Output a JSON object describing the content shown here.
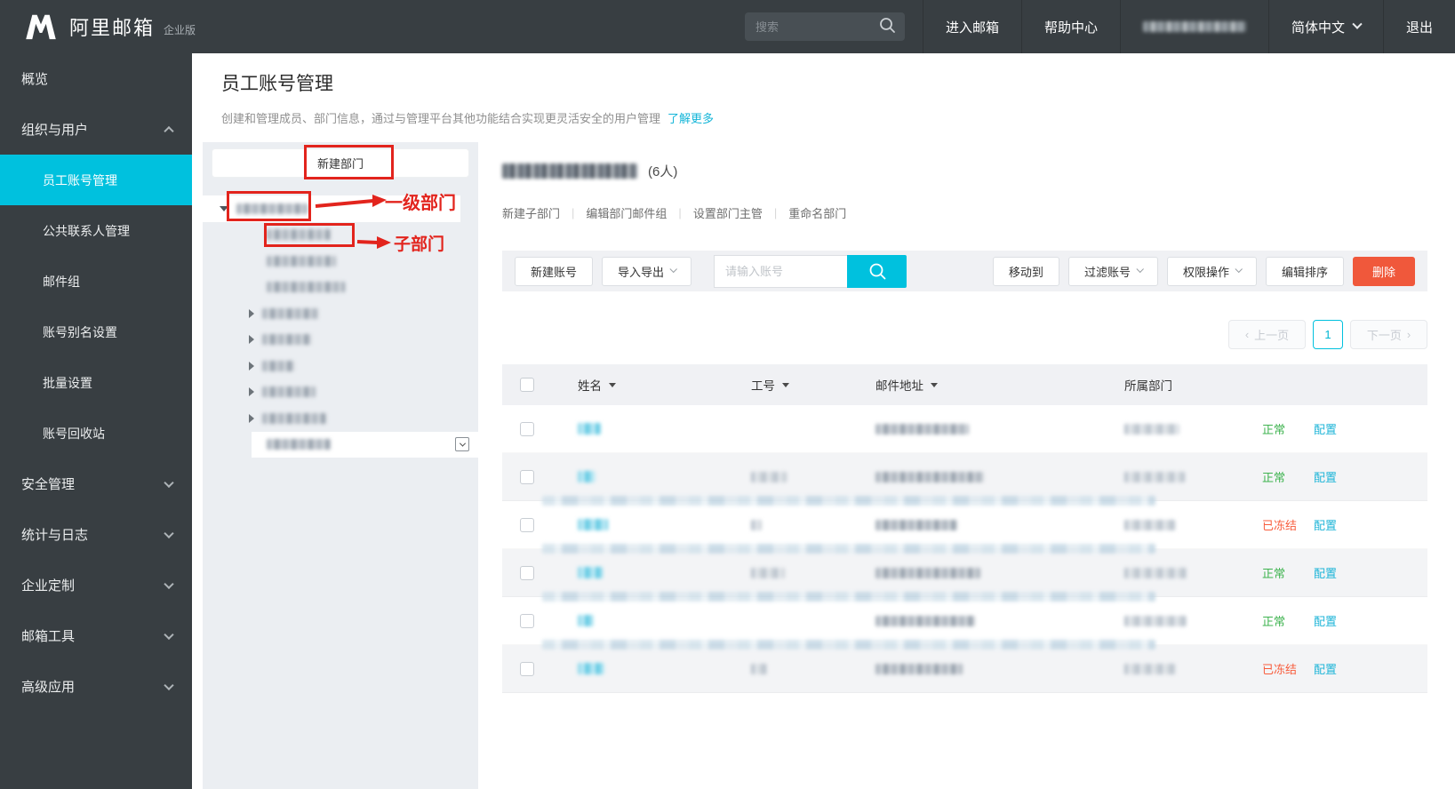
{
  "topbar": {
    "brand": "阿里邮箱",
    "brand_badge": "企业版",
    "search_placeholder": "搜索",
    "menu": [
      "进入邮箱",
      "帮助中心"
    ],
    "language": "简体中文",
    "logout": "退出"
  },
  "sidebar": {
    "items": [
      {
        "label": "概览",
        "level": 0
      },
      {
        "label": "组织与用户",
        "level": 0,
        "chevron": "up"
      },
      {
        "label": "员工账号管理",
        "level": 1,
        "active": true
      },
      {
        "label": "公共联系人管理",
        "level": 1
      },
      {
        "label": "邮件组",
        "level": 1
      },
      {
        "label": "账号别名设置",
        "level": 1
      },
      {
        "label": "批量设置",
        "level": 1
      },
      {
        "label": "账号回收站",
        "level": 1
      },
      {
        "label": "安全管理",
        "level": 0,
        "chevron": "down"
      },
      {
        "label": "统计与日志",
        "level": 0,
        "chevron": "down"
      },
      {
        "label": "企业定制",
        "level": 0,
        "chevron": "down"
      },
      {
        "label": "邮箱工具",
        "level": 0,
        "chevron": "down"
      },
      {
        "label": "高级应用",
        "level": 0,
        "chevron": "down"
      }
    ]
  },
  "page_header": {
    "title": "员工账号管理",
    "description": "创建和管理成员、部门信息，通过与管理平台其他功能结合实现更灵活安全的用户管理",
    "learn_more": "了解更多"
  },
  "tree": {
    "new_department_button": "新建部门",
    "annotations": {
      "level1": "一级部门",
      "sub": "子部门"
    },
    "nodes": [
      {
        "caret": "down",
        "level": 0,
        "blur_w": 80,
        "highlight": true,
        "boxed": true
      },
      {
        "caret": "none",
        "level": 1,
        "blur_w": 72,
        "boxed": true
      },
      {
        "caret": "none",
        "level": 1,
        "blur_w": 78
      },
      {
        "caret": "none",
        "level": 1,
        "blur_w": 88
      },
      {
        "caret": "right",
        "level": 1,
        "blur_w": 63
      },
      {
        "caret": "right",
        "level": 1,
        "blur_w": 55
      },
      {
        "caret": "right",
        "level": 1,
        "blur_w": 36
      },
      {
        "caret": "right",
        "level": 1,
        "blur_w": 60
      },
      {
        "caret": "right",
        "level": 1,
        "blur_w": 72
      },
      {
        "caret": "none",
        "level": 1,
        "blur_w": 72,
        "highlight": true,
        "dropdown": true
      }
    ]
  },
  "department": {
    "member_count": "(6人)",
    "actions": [
      "新建子部门",
      "编辑部门邮件组",
      "设置部门主管",
      "重命名部门"
    ]
  },
  "toolbar": {
    "new_account": "新建账号",
    "import_export": "导入导出",
    "search_placeholder": "请输入账号",
    "move_to": "移动到",
    "filter_account": "过滤账号",
    "permission_ops": "权限操作",
    "edit_sort": "编辑排序",
    "delete": "删除"
  },
  "pagination": {
    "prev": "上一页",
    "current": "1",
    "next": "下一页"
  },
  "table": {
    "headers": [
      {
        "label": "姓名",
        "sortable": true
      },
      {
        "label": "工号",
        "sortable": true
      },
      {
        "label": "邮件地址",
        "sortable": true
      },
      {
        "label": "所属部门",
        "sortable": false
      }
    ],
    "status_normal": "正常",
    "status_frozen": "已冻结",
    "config_label": "配置",
    "rows": [
      {
        "status": "正常",
        "name_w": 26,
        "job_w": 0,
        "email_w": 105,
        "dept_w": 62
      },
      {
        "status": "正常",
        "name_w": 20,
        "job_w": 40,
        "email_w": 122,
        "dept_w": 68
      },
      {
        "status": "已冻结",
        "name_w": 34,
        "job_w": 12,
        "email_w": 92,
        "dept_w": 58
      },
      {
        "status": "正常",
        "name_w": 28,
        "job_w": 38,
        "email_w": 118,
        "dept_w": 70
      },
      {
        "status": "正常",
        "name_w": 18,
        "job_w": 0,
        "email_w": 112,
        "dept_w": 70
      },
      {
        "status": "已冻结",
        "name_w": 30,
        "job_w": 18,
        "email_w": 98,
        "dept_w": 58
      }
    ]
  },
  "colors": {
    "accent": "#00c1de",
    "link": "#13b5d8",
    "success": "#3eb34f",
    "danger": "#f85c3c",
    "delete_button": "#f0583b",
    "annotation_red": "#e2241d",
    "topbar_bg": "#383e42"
  }
}
